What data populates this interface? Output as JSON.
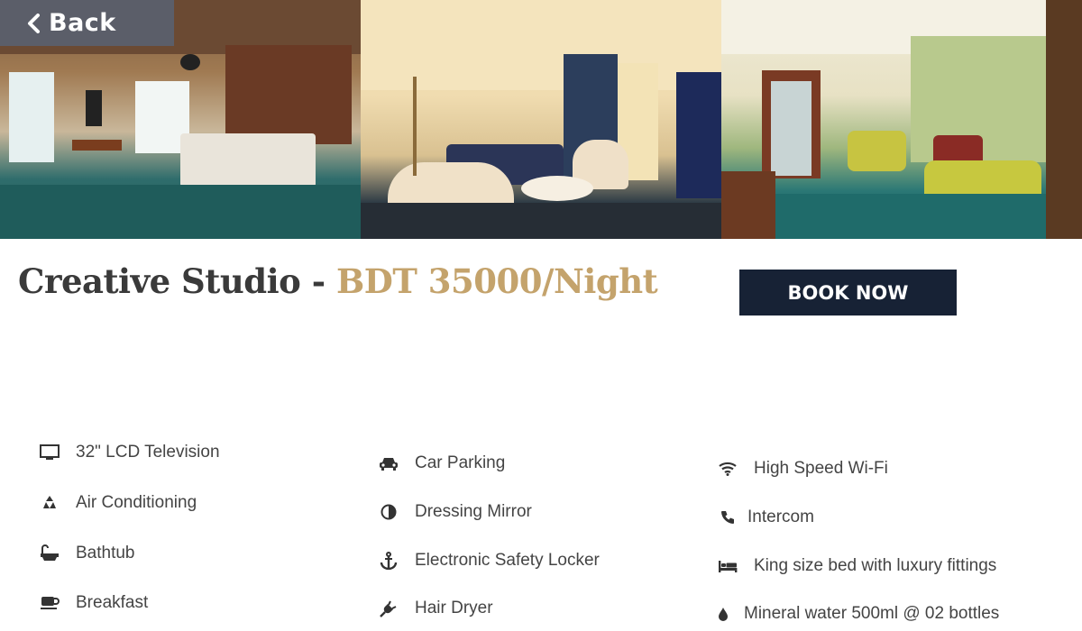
{
  "nav": {
    "back_label": "Back"
  },
  "room": {
    "name": "Creative Studio",
    "separator": " - ",
    "price": "BDT 35000/Night",
    "book_label": "BOOK NOW"
  },
  "amenities": {
    "col1": [
      {
        "label": "32\" LCD Television",
        "icon": "television-icon"
      },
      {
        "label": "Air Conditioning",
        "icon": "recycle-icon"
      },
      {
        "label": "Bathtub",
        "icon": "bathtub-icon"
      },
      {
        "label": "Breakfast",
        "icon": "coffee-cup-icon"
      }
    ],
    "col2": [
      {
        "label": "Car Parking",
        "icon": "car-icon"
      },
      {
        "label": "Dressing Mirror",
        "icon": "half-circle-icon"
      },
      {
        "label": "Electronic Safety Locker",
        "icon": "anchor-icon"
      },
      {
        "label": "Hair Dryer",
        "icon": "plug-icon"
      }
    ],
    "col3": [
      {
        "label": "High Speed Wi-Fi",
        "icon": "wifi-icon"
      },
      {
        "label": "Intercom",
        "icon": "phone-icon"
      },
      {
        "label": "King size bed with luxury fittings",
        "icon": "bed-icon"
      },
      {
        "label": "Mineral water 500ml @ 02 bottles",
        "icon": "water-drop-icon"
      }
    ]
  },
  "colors": {
    "accent_gold": "#c4a36c",
    "button_navy": "#172235",
    "back_bg": "#5a606e"
  }
}
